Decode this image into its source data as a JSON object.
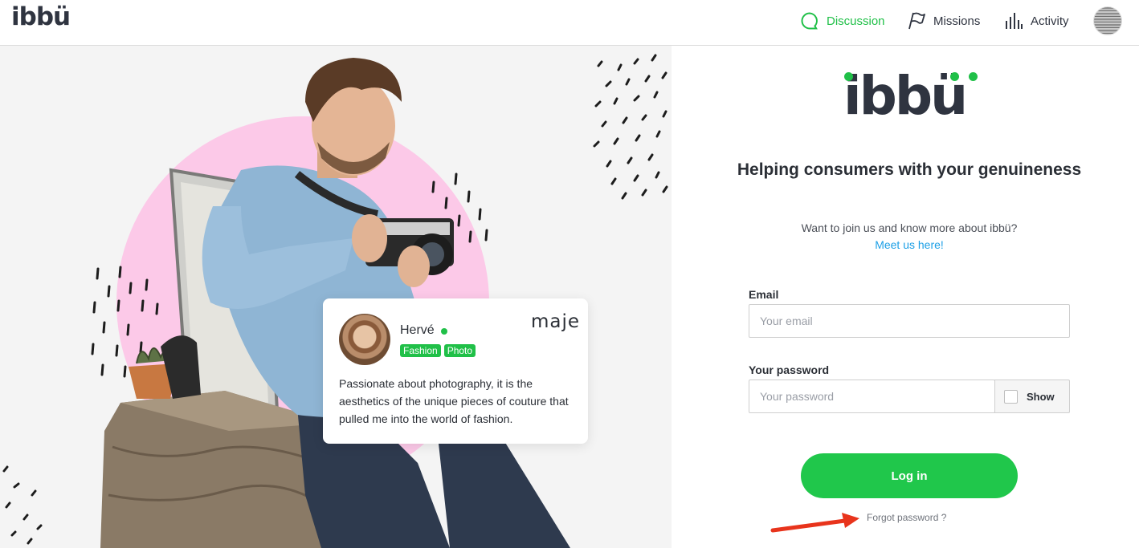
{
  "topbar": {
    "brand": "ibbü",
    "nav": [
      {
        "label": "Discussion",
        "icon": "chat-bubble-icon",
        "active": true
      },
      {
        "label": "Missions",
        "icon": "flag-icon",
        "active": false
      },
      {
        "label": "Activity",
        "icon": "bar-chart-icon",
        "active": false
      }
    ]
  },
  "profile_card": {
    "name": "Hervé",
    "brand": "maje",
    "tags": [
      "Fashion",
      "Photo"
    ],
    "bio": "Passionate about photography, it is the aesthetics of the unique pieces of couture that pulled me into the world of fashion."
  },
  "login": {
    "logo": "ibbü",
    "headline": "Helping consumers with your genuineness",
    "subline": "Want to join us and know more about ibbü?",
    "meet_link": "Meet us here!",
    "email_label": "Email",
    "email_placeholder": "Your email",
    "password_label": "Your password",
    "password_placeholder": "Your password",
    "show_label": "Show",
    "login_button": "Log in",
    "forgot_link": "Forgot password ?"
  },
  "colors": {
    "accent": "#20c048",
    "link": "#1ea0e6",
    "arrow": "#e8341c",
    "text": "#2b2f36"
  }
}
